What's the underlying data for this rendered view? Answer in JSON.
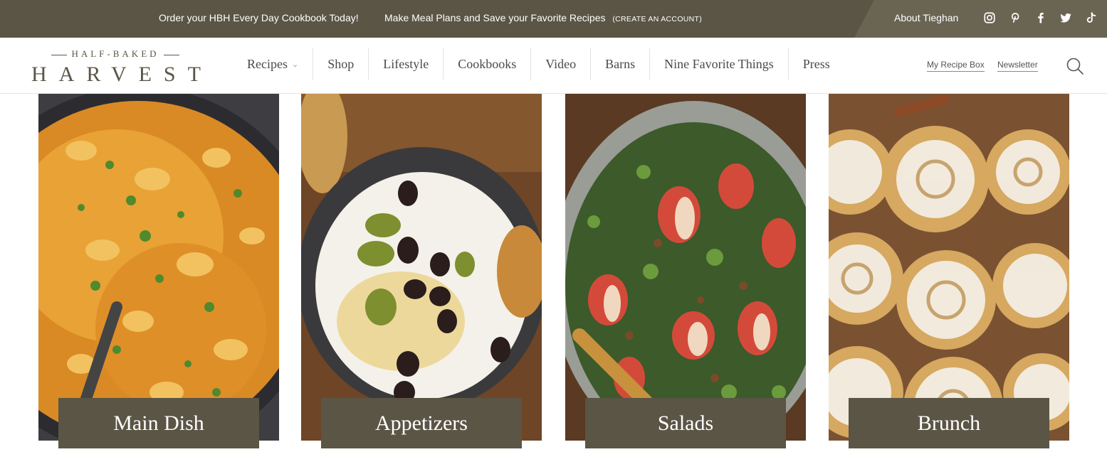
{
  "topbar": {
    "promo1": "Order your HBH Every Day Cookbook Today!",
    "promo2": "Make Meal Plans and Save your Favorite Recipes",
    "promo2_cta": "(CREATE AN ACCOUNT)",
    "about": "About Tieghan",
    "social_icons": [
      "instagram-icon",
      "pinterest-icon",
      "facebook-icon",
      "twitter-icon",
      "tiktok-icon"
    ]
  },
  "logo": {
    "top": "HALF-BAKED",
    "main": "HARVEST"
  },
  "nav": {
    "items": [
      "Recipes",
      "Shop",
      "Lifestyle",
      "Cookbooks",
      "Video",
      "Barns",
      "Nine Favorite Things",
      "Press"
    ]
  },
  "header_links": {
    "recipe_box": "My Recipe Box",
    "newsletter": "Newsletter"
  },
  "cards": [
    {
      "label": "Main Dish"
    },
    {
      "label": "Appetizers"
    },
    {
      "label": "Salads"
    },
    {
      "label": "Brunch"
    }
  ],
  "colors": {
    "topbar": "#5a5545",
    "label_bg": "#5a5545",
    "text_on_dark": "#ffffff"
  }
}
